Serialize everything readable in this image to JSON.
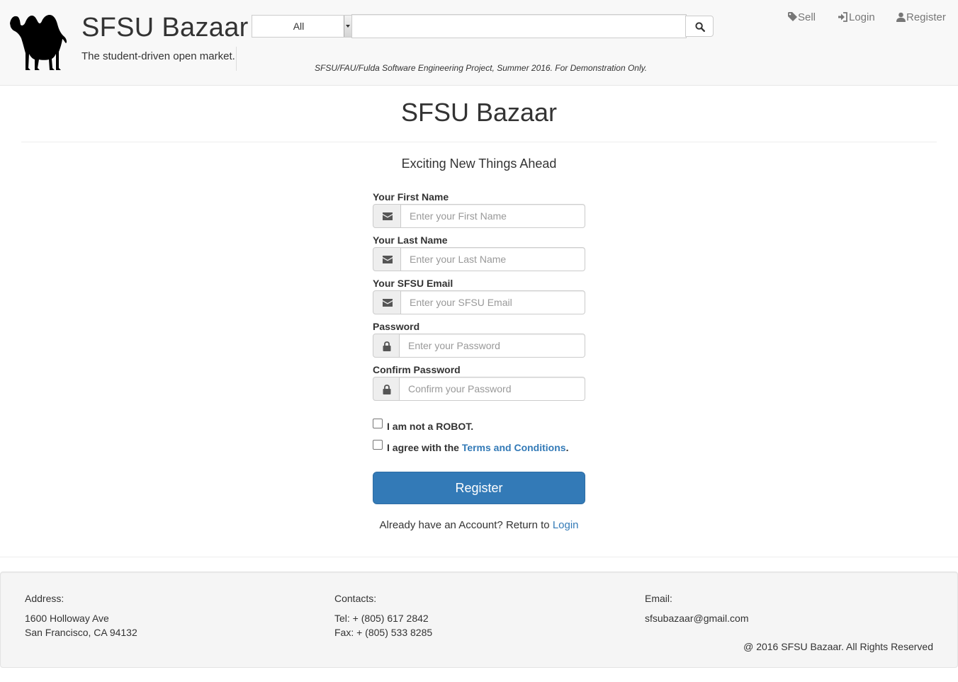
{
  "header": {
    "brand_title": "SFSU Bazaar",
    "tagline": "The student-driven open market.",
    "search": {
      "category_selected": "All",
      "query": "",
      "placeholder": ""
    },
    "disclaimer": "SFSU/FAU/Fulda Software Engineering Project, Summer 2016. For Demonstration Only.",
    "nav": [
      {
        "label": "Sell",
        "icon": "tag-icon"
      },
      {
        "label": "Login",
        "icon": "log-in-icon"
      },
      {
        "label": "Register",
        "icon": "user-icon"
      }
    ]
  },
  "main": {
    "title": "SFSU Bazaar",
    "subtitle": "Exciting New Things Ahead",
    "fields": [
      {
        "label": "Your First Name",
        "placeholder": "Enter your First Name",
        "icon": "envelope-icon",
        "value": ""
      },
      {
        "label": "Your Last Name",
        "placeholder": "Enter your Last Name",
        "icon": "envelope-icon",
        "value": ""
      },
      {
        "label": "Your SFSU Email",
        "placeholder": "Enter your SFSU Email",
        "icon": "envelope-icon",
        "value": ""
      },
      {
        "label": "Password",
        "placeholder": "Enter your Password",
        "icon": "lock-icon",
        "value": ""
      },
      {
        "label": "Confirm Password",
        "placeholder": "Confirm your Password",
        "icon": "lock-icon",
        "value": ""
      }
    ],
    "robot_check": {
      "label": "I am not a ROBOT.",
      "checked": false
    },
    "terms_check": {
      "prefix": "I agree with the",
      "link": "Terms and Conditions",
      "suffix": ".",
      "checked": false
    },
    "register_button": "Register",
    "login_prompt": {
      "text": "Already have an Account? Return to",
      "link": "Login"
    }
  },
  "footer": {
    "address": {
      "heading": "Address:",
      "line1": "1600 Holloway Ave",
      "line2": "San Francisco, CA 94132"
    },
    "contacts": {
      "heading": "Contacts:",
      "tel": "Tel: + (805) 617 2842",
      "fax": "Fax: + (805) 533 8285"
    },
    "email": {
      "heading": "Email:",
      "value": "sfsubazaar@gmail.com"
    },
    "copyright": "@ 2016 SFSU Bazaar. All Rights Reserved"
  },
  "colors": {
    "primary": "#337ab7",
    "header_bg": "#f8f8f8",
    "footer_bg": "#f5f5f5",
    "nav_text": "#777777"
  }
}
